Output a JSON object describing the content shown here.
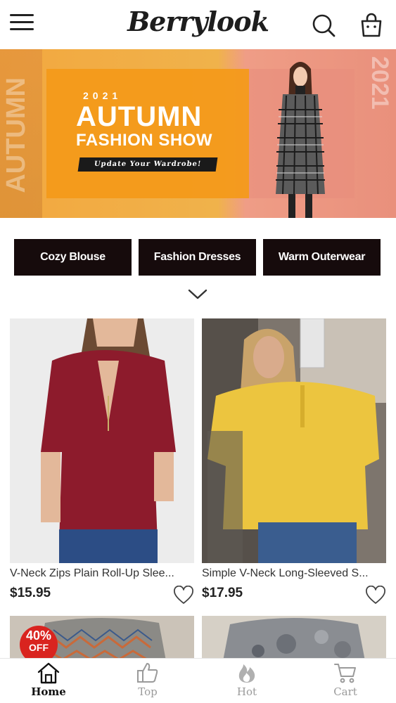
{
  "header": {
    "logo_text": "Berrylook",
    "menu_icon": "hamburger-menu-icon",
    "search_icon": "search-icon",
    "bag_icon": "shopping-bag-icon"
  },
  "banner": {
    "year": "2021",
    "title_line1": "AUTUMN",
    "title_line2": "FASHION SHOW",
    "tagline": "Update Your Wardrobe!",
    "side_text_left": "AUTUMN",
    "side_text_right": "2021",
    "colors": {
      "orange": "#f39a1a",
      "pink": "#e88d7b"
    }
  },
  "categories": [
    {
      "label": "Cozy Blouse"
    },
    {
      "label": "Fashion Dresses"
    },
    {
      "label": "Warm Outerwear"
    }
  ],
  "expand_icon": "chevron-down-icon",
  "products": [
    {
      "name": "V-Neck Zips Plain Roll-Up Slee...",
      "price": "$15.95",
      "color": "#8b1a2b"
    },
    {
      "name": "Simple V-Neck Long-Sleeved S...",
      "price": "$17.95",
      "color": "#e9c43e"
    },
    {
      "badge_percent": "40%",
      "badge_text": "OFF"
    },
    {}
  ],
  "bottom_nav": [
    {
      "label": "Home",
      "icon": "home-icon",
      "active": true
    },
    {
      "label": "Top",
      "icon": "thumbs-up-icon",
      "active": false
    },
    {
      "label": "Hot",
      "icon": "flame-icon",
      "active": false
    },
    {
      "label": "Cart",
      "icon": "cart-icon",
      "active": false
    }
  ]
}
